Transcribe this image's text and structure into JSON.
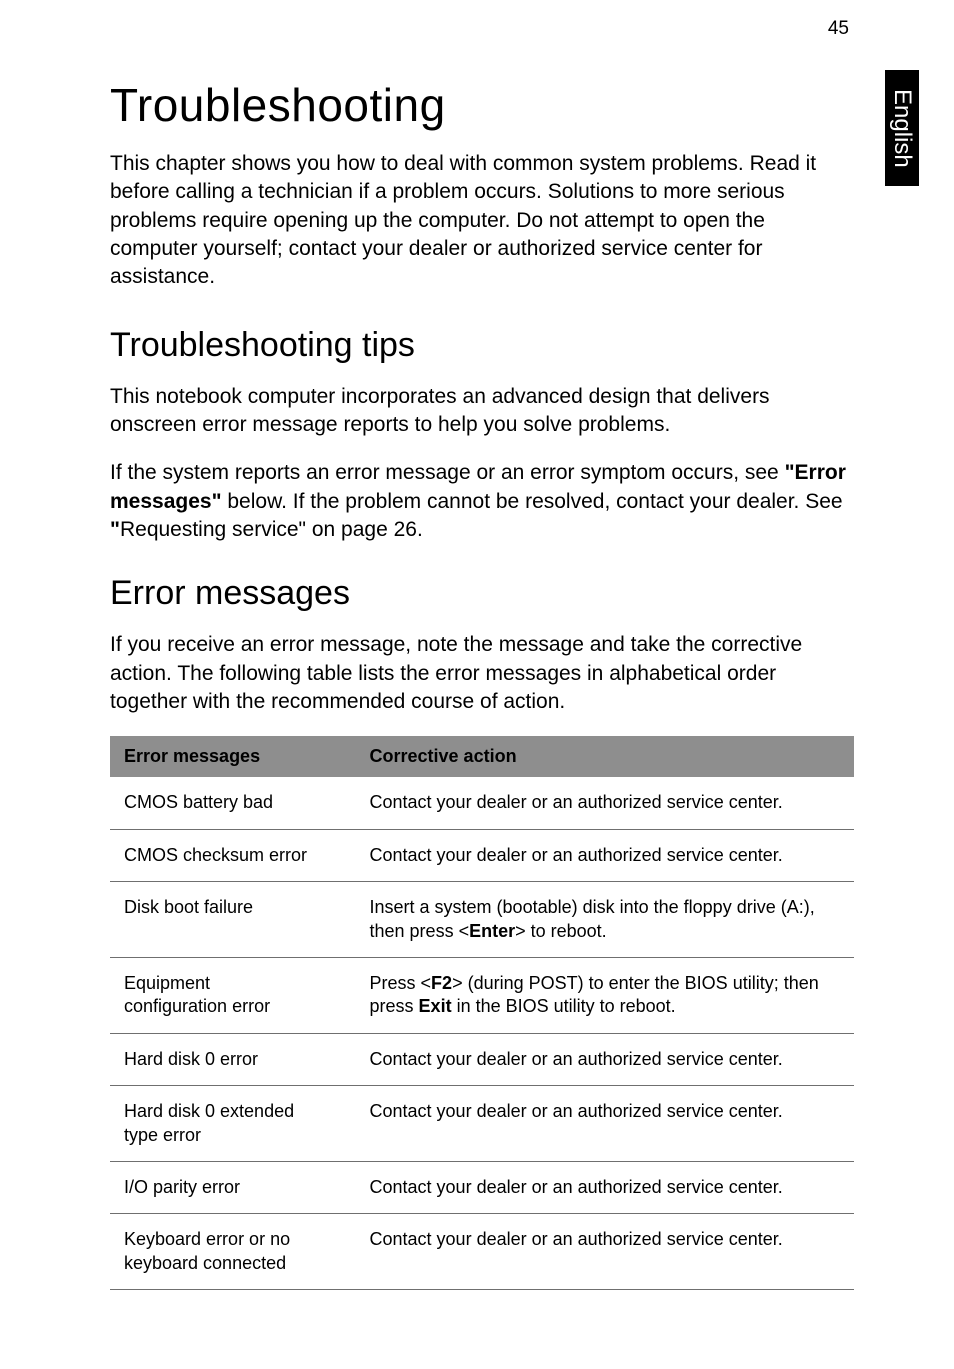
{
  "page_number": "45",
  "side_tab": "English",
  "headings": {
    "main": "Troubleshooting",
    "tips": "Troubleshooting tips",
    "errors": "Error messages"
  },
  "paragraphs": {
    "intro": "This chapter shows you how to deal with common system problems. Read it before calling a technician if a problem occurs. Solutions to more serious problems require opening up the computer. Do not attempt to open the computer yourself; contact your dealer or authorized service center for assistance.",
    "tips_p1": "This notebook computer incorporates an advanced design that delivers onscreen error message reports to help you solve problems.",
    "tips_p2_a": "If the system reports an error message or an error symptom occurs, see ",
    "tips_p2_bold1": "\"Error messages\"",
    "tips_p2_b": " below. If the problem cannot be resolved, contact your dealer. See ",
    "tips_p2_bold2": "\"",
    "tips_p2_c": "Requesting service\" on page 26.",
    "errors_p1": "If you receive an error message, note the message and take the corrective action. The following table lists the error messages in alphabetical order together with the recommended course of action."
  },
  "table": {
    "headers": {
      "col1": "Error messages",
      "col2": "Corrective action"
    },
    "rows": [
      {
        "c1": "CMOS battery bad",
        "c2": "Contact your dealer or an authorized service center."
      },
      {
        "c1": "CMOS checksum error",
        "c2": "Contact your dealer or an authorized service center."
      },
      {
        "c1": "Disk boot failure",
        "c2_a": "Insert a system (bootable) disk into the floppy drive (A:), then press <",
        "c2_bold": "Enter",
        "c2_b": "> to reboot."
      },
      {
        "c1a": "Equipment",
        "c1b": "configuration error",
        "c2_a": "Press <",
        "c2_bold1": "F2",
        "c2_b": "> (during POST) to enter the BIOS utility; then press ",
        "c2_bold2": "Exit",
        "c2_c": " in the BIOS utility to reboot."
      },
      {
        "c1": "Hard disk 0 error",
        "c2": "Contact your dealer or an authorized service center."
      },
      {
        "c1a": "Hard disk 0 extended",
        "c1b": "type error",
        "c2": "Contact your dealer or an authorized service center."
      },
      {
        "c1": "I/O parity error",
        "c2": "Contact your dealer or an authorized service center."
      },
      {
        "c1a": "Keyboard error or no",
        "c1b": "keyboard connected",
        "c2": "Contact your dealer or an authorized service center."
      }
    ]
  }
}
